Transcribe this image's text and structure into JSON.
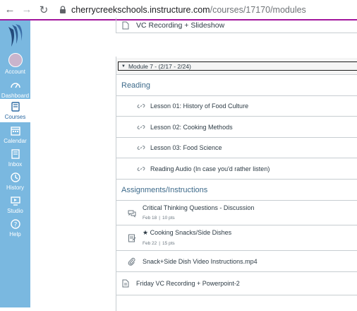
{
  "browser": {
    "url_host": "cherrycreekschools.instructure.com",
    "url_path": "/courses/17170/modules",
    "back_icon": "arrow-left-icon",
    "forward_icon": "arrow-right-icon",
    "reload_icon": "reload-icon",
    "lock_icon": "lock-icon"
  },
  "global_nav": {
    "items": [
      {
        "label": "Account",
        "icon": "avatar"
      },
      {
        "label": "Dashboard",
        "icon": "speedometer-icon"
      },
      {
        "label": "Courses",
        "icon": "book-icon"
      },
      {
        "label": "Calendar",
        "icon": "calendar-icon"
      },
      {
        "label": "Inbox",
        "icon": "inbox-icon"
      },
      {
        "label": "History",
        "icon": "clock-icon"
      },
      {
        "label": "Studio",
        "icon": "studio-icon"
      },
      {
        "label": "Help",
        "icon": "question-icon"
      }
    ],
    "active": "Courses",
    "bg_color": "#7ab8e0"
  },
  "previous_item": {
    "title": "VC Recording + Slideshow"
  },
  "module": {
    "title": "Module 7 - (2/17 - 2/24)",
    "sections": [
      {
        "header": "Reading"
      },
      {
        "header": "Assignments/Instructions"
      }
    ],
    "reading_items": [
      {
        "title": "Lesson 01: History of Food Culture",
        "icon": "link-icon"
      },
      {
        "title": "Lesson 02: Cooking Methods",
        "icon": "link-icon"
      },
      {
        "title": "Lesson 03: Food Science",
        "icon": "link-icon"
      },
      {
        "title": "Reading Audio (In case you'd rather listen)",
        "icon": "link-icon"
      }
    ],
    "assignment_items": [
      {
        "title": "Critical Thinking Questions - Discussion",
        "date": "Feb 18",
        "points": "10 pts",
        "icon": "discussion-icon"
      },
      {
        "title": "★ Cooking Snacks/Side Dishes",
        "date": "Feb 22",
        "points": "15 pts",
        "icon": "assignment-icon"
      },
      {
        "title": "Snack+Side Dish Video Instructions.mp4",
        "icon": "attachment-icon"
      }
    ],
    "final_item": {
      "title": "Friday VC Recording + Powerpoint-2",
      "icon": "document-icon"
    }
  }
}
